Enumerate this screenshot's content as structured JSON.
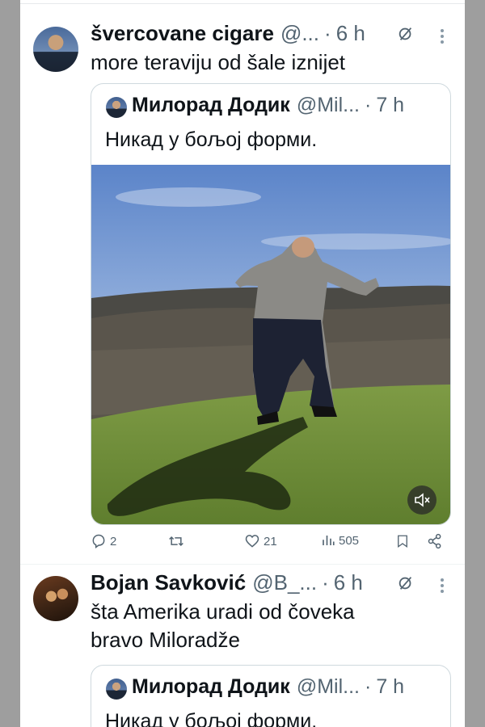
{
  "tweet1": {
    "author_name": "švercovane cigare",
    "handle": "@...",
    "separator": "·",
    "time": "6 h",
    "text": "more teraviju od šale iznijet",
    "quote": {
      "author_name": "Милорад Додик",
      "handle": "@Mil...",
      "separator": "·",
      "time": "7 h",
      "text": "Никад у бољој форми."
    },
    "actions": {
      "replies": "2",
      "retweets": "",
      "likes": "21",
      "views": "505"
    }
  },
  "tweet2": {
    "author_name": "Bojan Savković",
    "handle": "@B_...",
    "separator": "·",
    "time": "6 h",
    "text_line1": "šta Amerika uradi od čoveka",
    "text_line2": "bravo Miloradže",
    "quote": {
      "author_name": "Милорад Додик",
      "handle": "@Mil...",
      "separator": "·",
      "time": "7 h",
      "text": "Никад у бољој форми."
    }
  },
  "icons": [
    "retweet-icon",
    "more-icon",
    "reply-icon",
    "like-icon",
    "views-icon",
    "bookmark-icon",
    "share-icon",
    "mute-icon"
  ],
  "colors": {
    "text": "#0f1419",
    "secondary": "#536471",
    "border": "#cfd9de",
    "background": "#ffffff"
  }
}
